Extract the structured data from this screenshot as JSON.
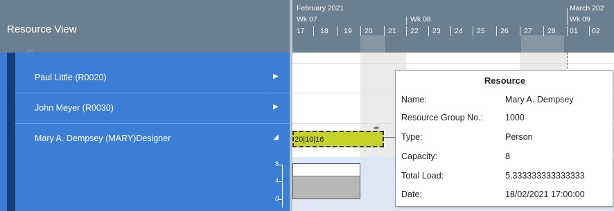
{
  "left": {
    "title": "Resource View",
    "ghost_row": "...",
    "rows": [
      {
        "label": "Paul Little (R0020)",
        "arrow": "▶"
      },
      {
        "label": "John Meyer (R0030)",
        "arrow": "▶"
      },
      {
        "label": "Mary A. Dempsey (MARY)Designer",
        "arrow": "◢"
      }
    ],
    "yaxis": {
      "top": "8",
      "mid": "4",
      "bottom": "0"
    }
  },
  "timeline": {
    "months": [
      "February 2021",
      "March 202"
    ],
    "weeks": [
      "Wk 07",
      "Wk 08",
      "Wk 09"
    ],
    "days": [
      "17",
      "18",
      "19",
      "20",
      "21",
      "22",
      "23",
      "24",
      "25",
      "26",
      "27",
      "28",
      "01",
      "02"
    ],
    "task_label": "20|10|16"
  },
  "tooltip": {
    "title": "Resource",
    "fields": [
      {
        "key": "Name:",
        "value": "Mary A. Dempsey"
      },
      {
        "key": "Resource Group No.:",
        "value": "1000"
      },
      {
        "key": "Type:",
        "value": "Person"
      },
      {
        "key": "Capacity:",
        "value": "8"
      },
      {
        "key": "Total Load:",
        "value": "5.333333333333333"
      },
      {
        "key": "Date:",
        "value": "18/02/2021 17:00:00"
      }
    ]
  }
}
